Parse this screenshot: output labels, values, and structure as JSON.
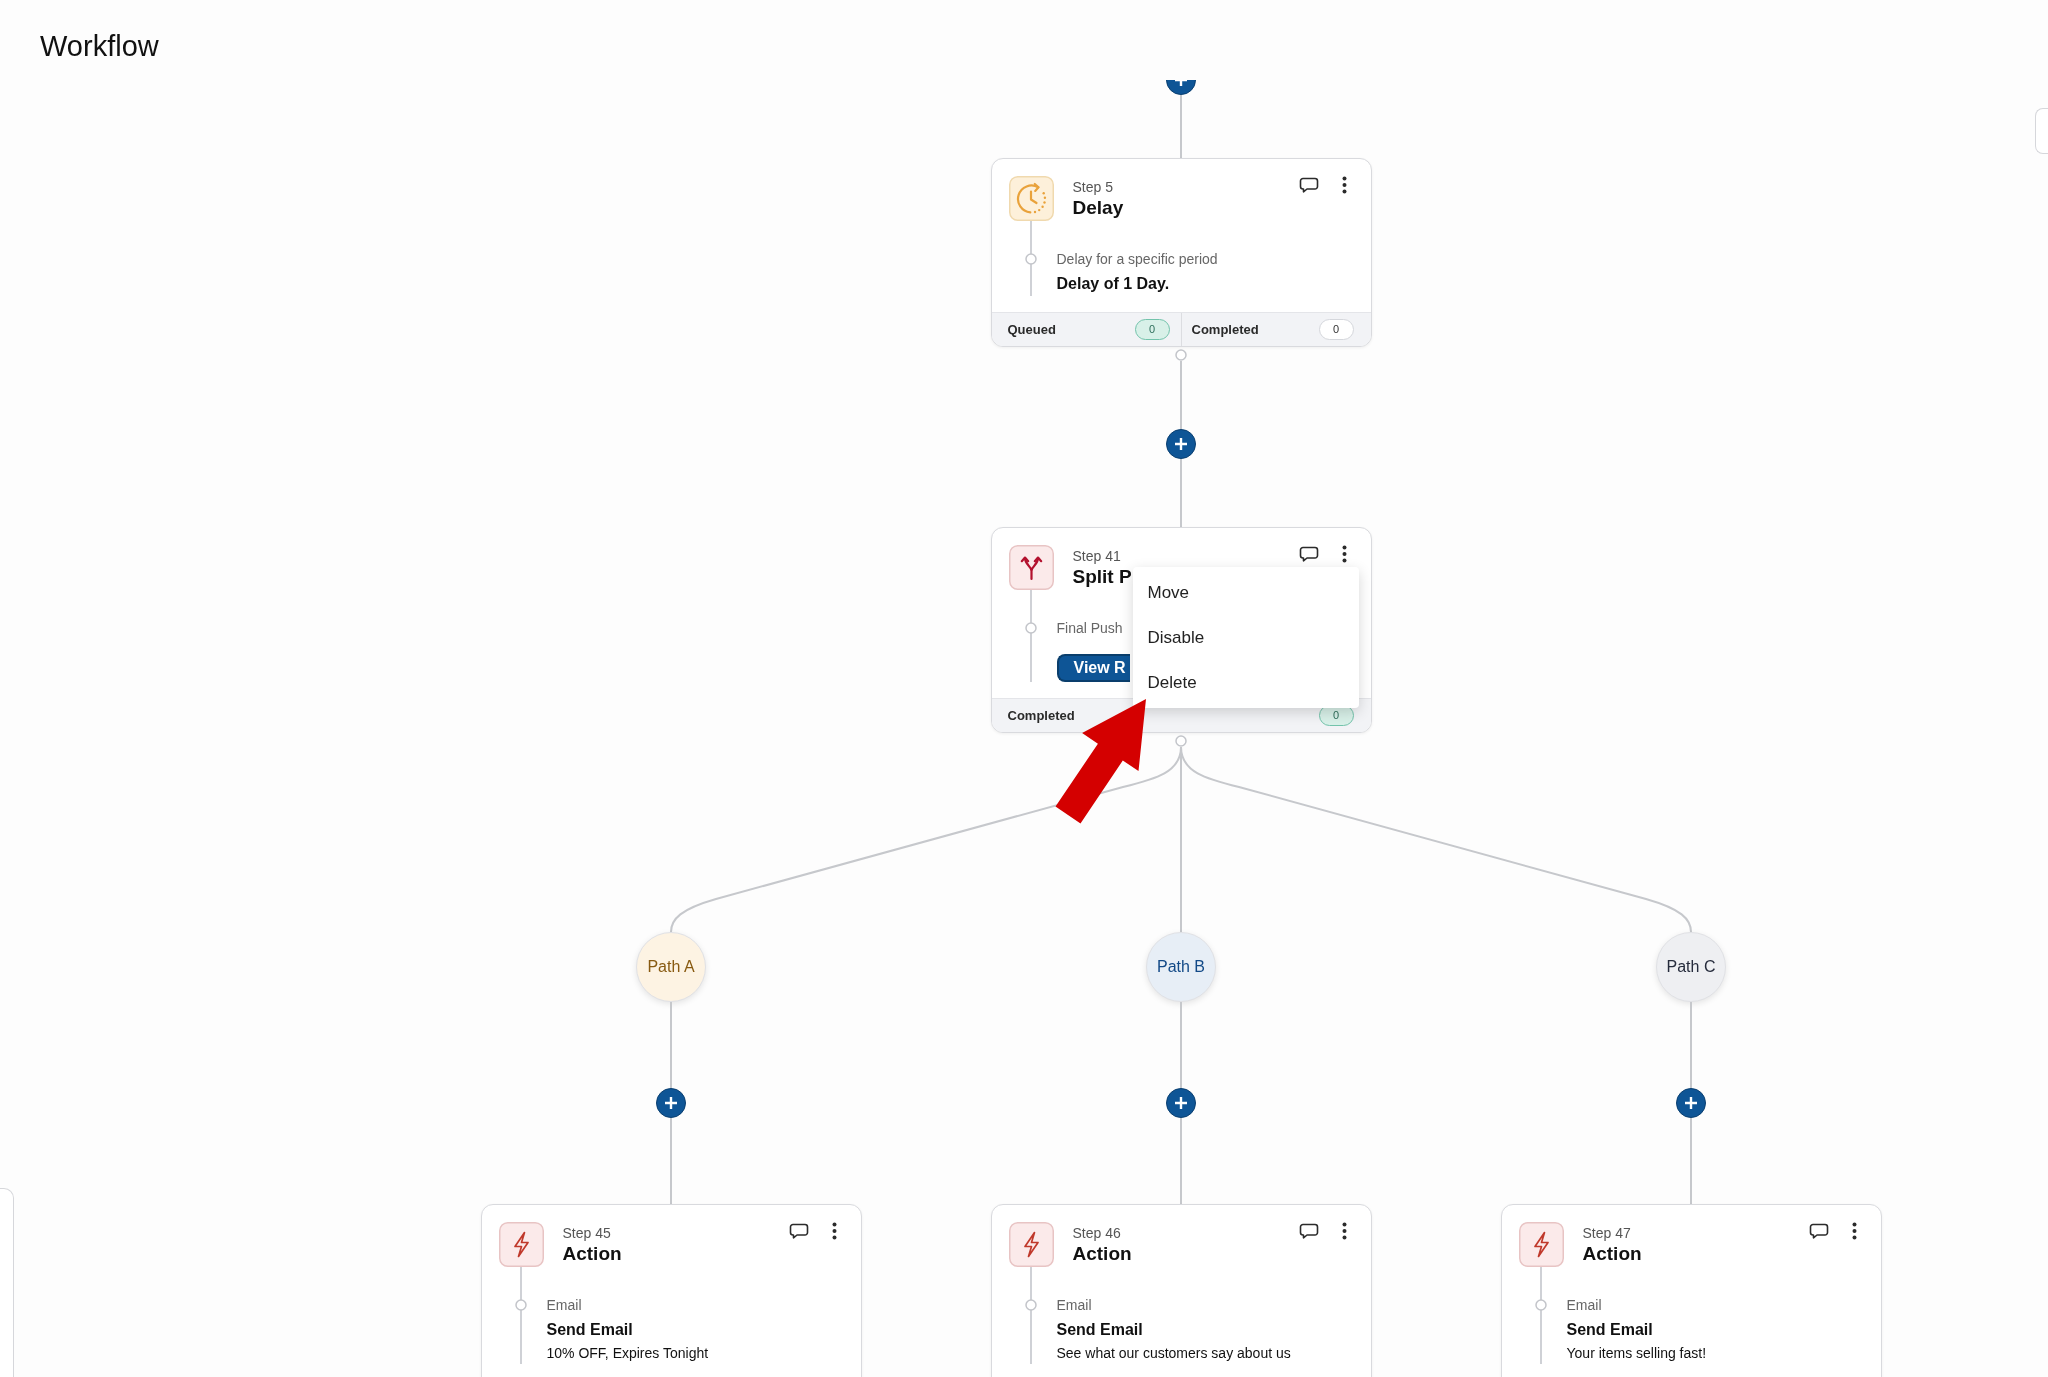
{
  "header": {
    "title": "Workflow"
  },
  "workflow": {
    "steps": [
      {
        "kind": "delay",
        "step": "Step 5",
        "title": "Delay",
        "detail_label": "Delay for a specific period",
        "detail": "Delay of 1 Day.",
        "stats": [
          {
            "label": "Queued",
            "count": "0",
            "highlighted": true
          },
          {
            "label": "Completed",
            "count": "0",
            "highlighted": false
          }
        ]
      },
      {
        "kind": "split",
        "step": "Step 41",
        "title": "Split P",
        "detail_label": "Final Push",
        "button": "View R",
        "stats": [
          {
            "label": "Completed",
            "count": "0",
            "highlighted": true
          }
        ],
        "menu": {
          "items": [
            "Move",
            "Disable",
            "Delete"
          ]
        }
      }
    ],
    "paths": [
      {
        "label": "Path A",
        "color": "#fdf3e3",
        "step": {
          "kind": "action",
          "step": "Step 45",
          "title": "Action",
          "detail_label": "Email",
          "detail": "Send Email",
          "subject": "10% OFF, Expires Tonight"
        }
      },
      {
        "label": "Path B",
        "color": "#e7eef6",
        "step": {
          "kind": "action",
          "step": "Step 46",
          "title": "Action",
          "detail_label": "Email",
          "detail": "Send Email",
          "subject": "See what our customers say about us"
        }
      },
      {
        "label": "Path C",
        "color": "#eeeff2",
        "step": {
          "kind": "action",
          "step": "Step 47",
          "title": "Action",
          "detail_label": "Email",
          "detail": "Send Email",
          "subject": "Your items selling fast!"
        }
      }
    ]
  }
}
